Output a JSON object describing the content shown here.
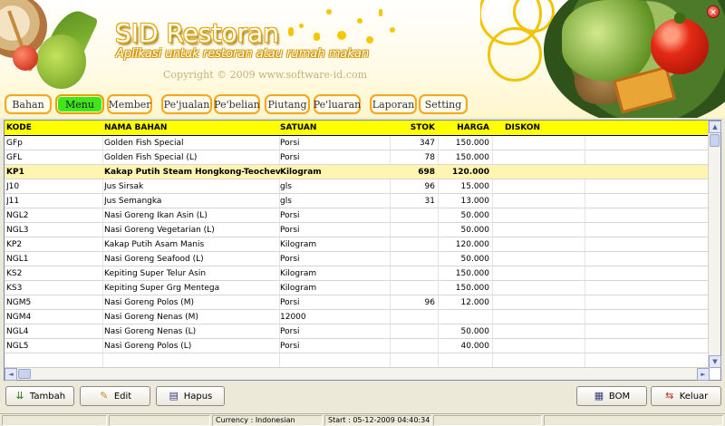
{
  "app": {
    "title": "SID Restoran",
    "tagline": "Aplikasi untuk restoran atau rumah makan",
    "copyright": "Copyright © 2009 www.software-id.com",
    "close_symbol": "×"
  },
  "menu": {
    "items": [
      {
        "label": "Bahan"
      },
      {
        "label": "Menu"
      },
      {
        "label": "Member"
      },
      {
        "label": "Pe'jualan"
      },
      {
        "label": "Pe'belian"
      },
      {
        "label": "Piutang"
      },
      {
        "label": "Pe'luaran"
      },
      {
        "label": "Laporan"
      },
      {
        "label": "Setting"
      }
    ],
    "active": "Menu",
    "active_color": "#3fe61b",
    "border_color": "#f5a623"
  },
  "grid": {
    "columns": [
      "KODE",
      "NAMA BAHAN",
      "SATUAN",
      "STOK",
      "HARGA",
      "DISKON"
    ],
    "header_color": "#ffff00",
    "rows": [
      {
        "kode": "GFp",
        "nama": "Golden Fish Special",
        "satuan": "Porsi",
        "stok": "347",
        "harga": "150.000",
        "diskon": ""
      },
      {
        "kode": "GFL",
        "nama": "Golden Fish Special (L)",
        "satuan": "Porsi",
        "stok": "78",
        "harga": "150.000",
        "diskon": ""
      },
      {
        "kode": "KP1",
        "nama": "Kakap Putih Steam Hongkong-Teochev",
        "satuan": "Kilogram",
        "stok": "698",
        "harga": "120.000",
        "diskon": ""
      },
      {
        "kode": "J10",
        "nama": "Jus Sirsak",
        "satuan": "gls",
        "stok": "96",
        "harga": "15.000",
        "diskon": ""
      },
      {
        "kode": "J11",
        "nama": "Jus Semangka",
        "satuan": "gls",
        "stok": "31",
        "harga": "13.000",
        "diskon": ""
      },
      {
        "kode": "NGL2",
        "nama": "Nasi Goreng Ikan Asin (L)",
        "satuan": "Porsi",
        "stok": "",
        "harga": "50.000",
        "diskon": ""
      },
      {
        "kode": "NGL3",
        "nama": "Nasi Goreng Vegetarian (L)",
        "satuan": "Porsi",
        "stok": "",
        "harga": "50.000",
        "diskon": ""
      },
      {
        "kode": "KP2",
        "nama": "Kakap Putih Asam Manis",
        "satuan": "Kilogram",
        "stok": "",
        "harga": "120.000",
        "diskon": ""
      },
      {
        "kode": "NGL1",
        "nama": "Nasi Goreng Seafood (L)",
        "satuan": "Porsi",
        "stok": "",
        "harga": "50.000",
        "diskon": ""
      },
      {
        "kode": "KS2",
        "nama": "Kepiting Super Telur Asin",
        "satuan": "Kilogram",
        "stok": "",
        "harga": "150.000",
        "diskon": ""
      },
      {
        "kode": "KS3",
        "nama": "Kepiting Super Grg Mentega",
        "satuan": "Kilogram",
        "stok": "",
        "harga": "150.000",
        "diskon": ""
      },
      {
        "kode": "NGM5",
        "nama": "Nasi Goreng Polos (M)",
        "satuan": "Porsi",
        "stok": "96",
        "harga": "12.000",
        "diskon": ""
      },
      {
        "kode": "NGM4",
        "nama": "Nasi Goreng Nenas (M)",
        "satuan": "12000",
        "stok": "",
        "harga": "",
        "diskon": ""
      },
      {
        "kode": "NGL4",
        "nama": "Nasi Goreng Nenas (L)",
        "satuan": "Porsi",
        "stok": "",
        "harga": "50.000",
        "diskon": ""
      },
      {
        "kode": "NGL5",
        "nama": "Nasi Goreng Polos (L)",
        "satuan": "Porsi",
        "stok": "",
        "harga": "40.000",
        "diskon": ""
      }
    ],
    "selected_kode": "KP1",
    "selected_color": "#fff5b0"
  },
  "scroll": {
    "up": "▲",
    "down": "▼",
    "left": "◄",
    "right": "►"
  },
  "actions": {
    "tambah": {
      "label": "Tambah",
      "icon": "down-arrows-icon"
    },
    "edit": {
      "label": "Edit",
      "icon": "pencil-icon"
    },
    "hapus": {
      "label": "Hapus",
      "icon": "delete-icon"
    },
    "bom": {
      "label": "BOM",
      "icon": "bom-icon"
    },
    "keluar": {
      "label": "Keluar",
      "icon": "exit-icon"
    }
  },
  "status": {
    "currency": "Currency : Indonesian",
    "start": "Start  : 05-12-2009 04:40:34"
  }
}
